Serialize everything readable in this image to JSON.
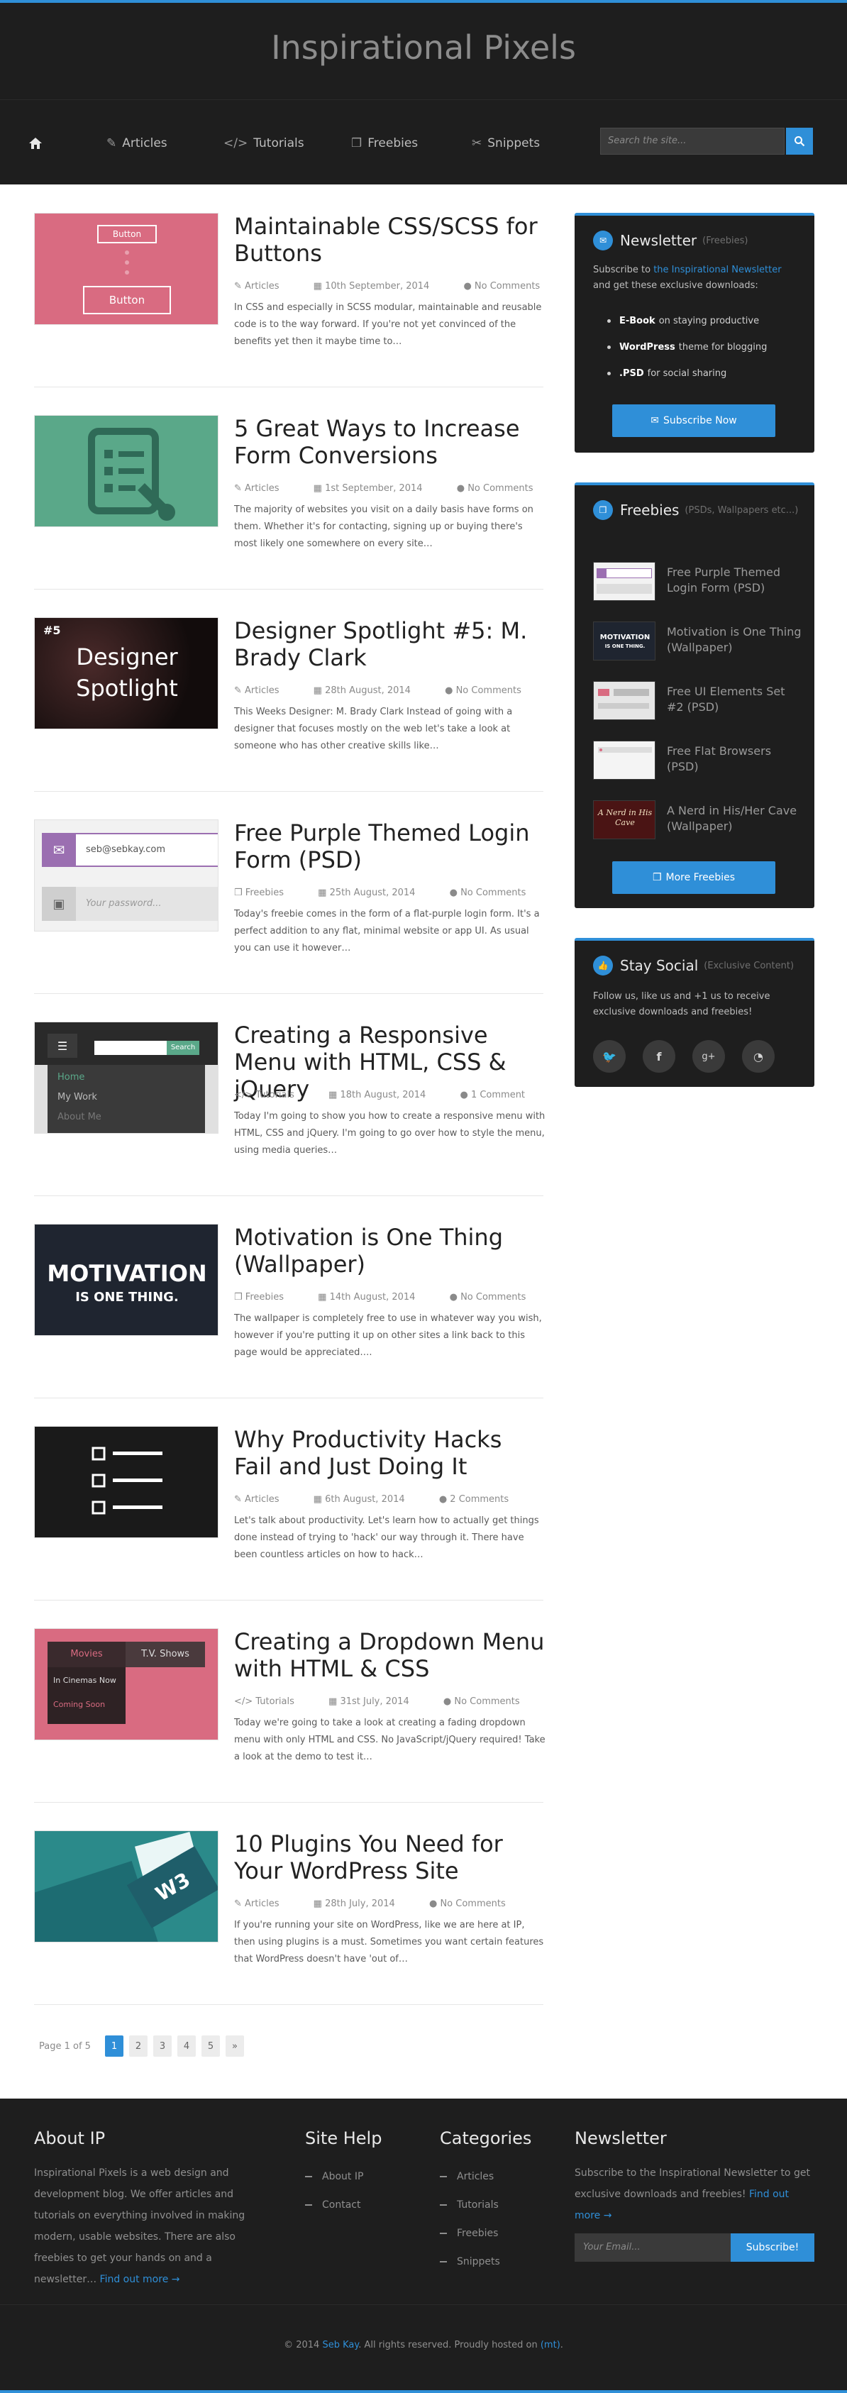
{
  "site": {
    "title": "Inspirational Pixels"
  },
  "nav": {
    "items": [
      {
        "label": "Articles",
        "icon": "edit-icon"
      },
      {
        "label": "Tutorials",
        "icon": "code-icon"
      },
      {
        "label": "Freebies",
        "icon": "gift-icon"
      },
      {
        "label": "Snippets",
        "icon": "scissors-icon"
      }
    ],
    "search_placeholder": "Search the site..."
  },
  "posts": [
    {
      "title": "Maintainable CSS/SCSS for Buttons",
      "category": "Articles",
      "date": "10th September, 2014",
      "comments": "No Comments",
      "excerpt": "In CSS and especially in SCSS modular, maintainable and reusable code is to the way forward. If you're not yet convinced of the benefits yet then it maybe time to…",
      "thumb": {
        "btn1": "Button",
        "btn2": "Button"
      }
    },
    {
      "title": "5 Great Ways to Increase Form Conversions",
      "category": "Articles",
      "date": "1st September, 2014",
      "comments": "No Comments",
      "excerpt": "The majority of websites you visit on a daily basis have forms on them. Whether it's for contacting, signing up or buying there's most likely one somewhere on every site…"
    },
    {
      "title": "Designer Spotlight #5: M. Brady Clark",
      "category": "Articles",
      "date": "28th August, 2014",
      "comments": "No Comments",
      "excerpt": "This Weeks Designer: M. Brady Clark Instead of going with a designer that focuses mostly on the web let's take a look at someone who has other creative skills like…",
      "thumb": {
        "number": "#5",
        "line1": "Designer",
        "line2": "Spotlight"
      }
    },
    {
      "title": "Free Purple Themed Login Form (PSD)",
      "category": "Freebies",
      "date": "25th August, 2014",
      "comments": "No Comments",
      "excerpt": "Today's freebie comes in the form of a flat-purple login form. It's a perfect addition to any flat, minimal website or app UI. As usual you can use it however…",
      "thumb": {
        "email": "seb@sebkay.com",
        "password": "Your password..."
      }
    },
    {
      "title": "Creating a Responsive Menu with HTML, CSS & jQuery",
      "category": "Tutorials",
      "date": "18th August, 2014",
      "comments": "1 Comment",
      "excerpt": "Today I'm going to show you how to create a responsive menu with HTML, CSS and jQuery. I'm going to go over how to style the menu, using media queries…",
      "thumb": {
        "search_btn": "Search",
        "item1": "Home",
        "item2": "My Work",
        "item3": "About Me"
      }
    },
    {
      "title": "Motivation is One Thing (Wallpaper)",
      "category": "Freebies",
      "date": "14th August, 2014",
      "comments": "No Comments",
      "excerpt": "The wallpaper is completely free to use in whatever way you wish, however if you're putting it up on other sites a link back to this page would be appreciated….",
      "thumb": {
        "line1": "MOTIVATION",
        "line2": "IS ONE THING."
      }
    },
    {
      "title": "Why Productivity Hacks Fail and Just Doing It",
      "category": "Articles",
      "date": "6th August, 2014",
      "comments": "2 Comments",
      "excerpt": "Let's talk about productivity. Let's learn how to actually get things done instead of trying to 'hack' our way through it. There have been countless articles on how to hack…"
    },
    {
      "title": "Creating a Dropdown Menu with HTML & CSS",
      "category": "Tutorials",
      "date": "31st July, 2014",
      "comments": "No Comments",
      "excerpt": "Today we're going to take a look at creating a fading dropdown menu with only HTML and CSS. No JavaScript/jQuery required! Take a look at the demo to test it…",
      "thumb": {
        "tab1": "Movies",
        "tab2": "T.V. Shows",
        "item1": "In Cinemas Now",
        "item2": "Coming Soon"
      }
    },
    {
      "title": "10 Plugins You Need for Your WordPress Site",
      "category": "Articles",
      "date": "28th July, 2014",
      "comments": "No Comments",
      "excerpt": "If you're running your site on WordPress, like we are here at IP, then using plugins is a must. Sometimes you want certain features that WordPress doesn't have 'out of…",
      "thumb": {
        "logo": "W3"
      }
    }
  ],
  "sidebar": {
    "newsletter": {
      "title": "Newsletter",
      "subtitle": "(Freebies)",
      "text_pre": "Subscribe to ",
      "text_link": "the Inspirational Newsletter",
      "text_post": " and get these exclusive downloads:",
      "items": [
        {
          "bold": "E-Book",
          "rest": "on staying productive"
        },
        {
          "bold": "WordPress",
          "rest": "theme for blogging"
        },
        {
          "bold": ".PSD",
          "rest": "for social sharing"
        }
      ],
      "button": "Subscribe Now"
    },
    "freebies": {
      "title": "Freebies",
      "subtitle": "(PSDs, Wallpapers etc...)",
      "items": [
        {
          "label": "Free Purple Themed Login Form (PSD)"
        },
        {
          "label": "Motivation is One Thing (Wallpaper)",
          "thumb_text": "MOTIVATION",
          "thumb_sub": "IS ONE THING."
        },
        {
          "label": "Free UI Elements Set #2 (PSD)"
        },
        {
          "label": "Free Flat Browsers (PSD)"
        },
        {
          "label": "A Nerd in His/Her Cave (Wallpaper)",
          "thumb_text": "A Nerd in His Cave"
        }
      ],
      "button": "More Freebies"
    },
    "social": {
      "title": "Stay Social",
      "subtitle": "(Exclusive Content)",
      "text": "Follow us, like us and +1 us to receive exclusive downloads and freebies!",
      "icons": [
        "twitter-icon",
        "facebook-icon",
        "google-plus-icon",
        "rss-icon"
      ]
    }
  },
  "pagination": {
    "label": "Page 1 of 5",
    "pages": [
      "1",
      "2",
      "3",
      "4",
      "5"
    ],
    "next": "»"
  },
  "footer": {
    "about": {
      "title": "About IP",
      "text": "Inspirational Pixels is a web design and development blog. We offer articles and tutorials on everything involved in making modern, usable websites. There are also freebies to get your hands on and a newsletter… ",
      "link": "Find out more →"
    },
    "help": {
      "title": "Site Help",
      "items": [
        "About IP",
        "Contact"
      ]
    },
    "categories": {
      "title": "Categories",
      "items": [
        "Articles",
        "Tutorials",
        "Freebies",
        "Snippets"
      ]
    },
    "newsletter": {
      "title": "Newsletter",
      "text": "Subscribe to the Inspirational Newsletter to get exclusive downloads and freebies! ",
      "link": "Find out more →",
      "placeholder": "Your Email...",
      "button": "Subscribe!"
    },
    "copyright": {
      "pre": "© 2014 ",
      "author": "Seb Kay",
      "mid": ". All rights reserved. Proudly hosted on ",
      "host": "(mt)",
      "post": "."
    }
  },
  "colors": {
    "accent": "#2f8fd8",
    "header_bg": "#1e1e1e",
    "thumb_pink": "#d96b81",
    "thumb_green": "#5aa889"
  }
}
